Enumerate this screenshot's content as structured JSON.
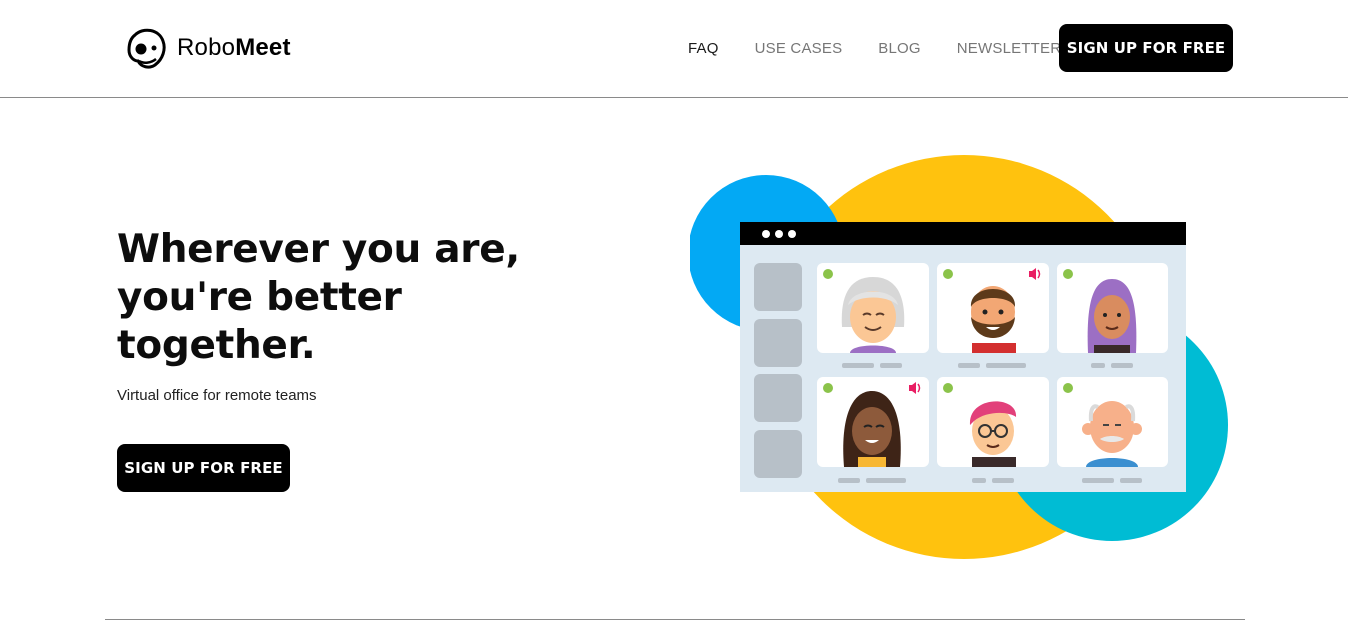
{
  "brand": {
    "name_regular": "Robo",
    "name_bold": "Meet"
  },
  "nav": {
    "items": [
      {
        "label": "FAQ",
        "active": true
      },
      {
        "label": "USE CASES",
        "active": false
      },
      {
        "label": "BLOG",
        "active": false
      },
      {
        "label": "NEWSLETTER",
        "active": false
      }
    ],
    "signup_label": "SIGN UP FOR FREE"
  },
  "hero": {
    "title_line1": "Wherever you are,",
    "title_line2": "you're better",
    "title_line3": "together.",
    "subtitle": "Virtual office for remote teams",
    "signup_label": "SIGN UP FOR FREE"
  },
  "illustration": {
    "colors": {
      "yellow": "#FFC20E",
      "blue": "#03A9F4",
      "teal": "#00BCD4",
      "panel": "#DDE9F2",
      "titlebar": "#000000",
      "tile": "#B7C0C8",
      "online_dot": "#8BC34A",
      "speaker": "#E91E63"
    },
    "participants": [
      {
        "name": "grey-haired-woman-avatar",
        "speaking": false
      },
      {
        "name": "bearded-man-avatar",
        "speaking": true
      },
      {
        "name": "hijab-woman-avatar",
        "speaking": false
      },
      {
        "name": "curly-hair-woman-avatar",
        "speaking": true
      },
      {
        "name": "pink-hair-glasses-avatar",
        "speaking": false
      },
      {
        "name": "bald-mustache-man-avatar",
        "speaking": false
      }
    ]
  }
}
